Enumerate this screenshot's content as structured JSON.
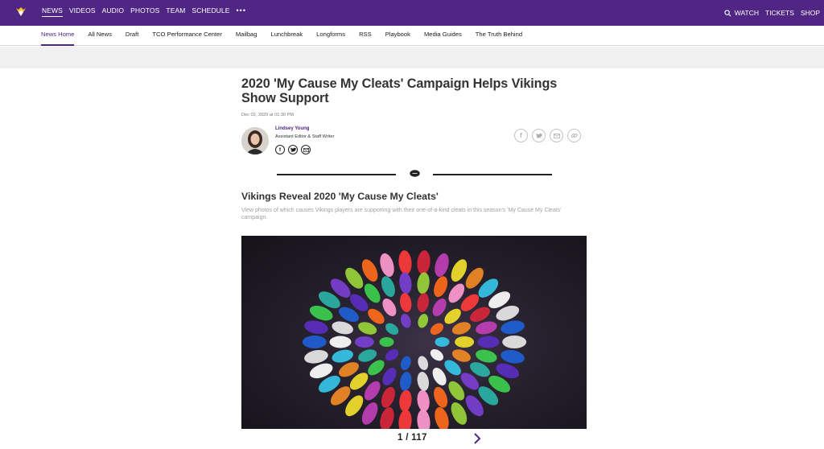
{
  "topbar": {
    "primary_nav": [
      {
        "label": "NEWS",
        "active": true
      },
      {
        "label": "VIDEOS",
        "active": false
      },
      {
        "label": "AUDIO",
        "active": false
      },
      {
        "label": "PHOTOS",
        "active": false
      },
      {
        "label": "TEAM",
        "active": false
      },
      {
        "label": "SCHEDULE",
        "active": false
      }
    ],
    "more": "•••",
    "watch": "WATCH",
    "tickets": "TICKETS",
    "shop": "SHOP"
  },
  "subnav": {
    "items": [
      "News Home",
      "All News",
      "Draft",
      "TCO Performance Center",
      "Mailbag",
      "Lunchbreak",
      "Longforms",
      "RSS",
      "Playbook",
      "Media Guides",
      "The Truth Behind"
    ]
  },
  "article": {
    "headline": "2020 'My Cause My Cleats' Campaign Helps Vikings Show Support",
    "date": "Dec 02, 2020 at 01:30 PM",
    "author": {
      "name": "Lindsey Young",
      "title": "Assistant Editor & Staff Writer"
    },
    "gallery": {
      "title": "Vikings Reveal 2020 'My Cause My Cleats'",
      "description": "View photos of which causes Vikings players are supporting with their one-of-a-kind cleats in this season's 'My Cause My Cleats' campaign.",
      "counter": "1 / 117"
    }
  },
  "colors": {
    "brand_purple": "#4f2683",
    "gold": "#ffc62f"
  },
  "icons": [
    "vikings-logo",
    "search-icon",
    "facebook-icon",
    "twitter-icon",
    "email-icon",
    "link-icon",
    "football-icon",
    "chevron-right-icon"
  ]
}
